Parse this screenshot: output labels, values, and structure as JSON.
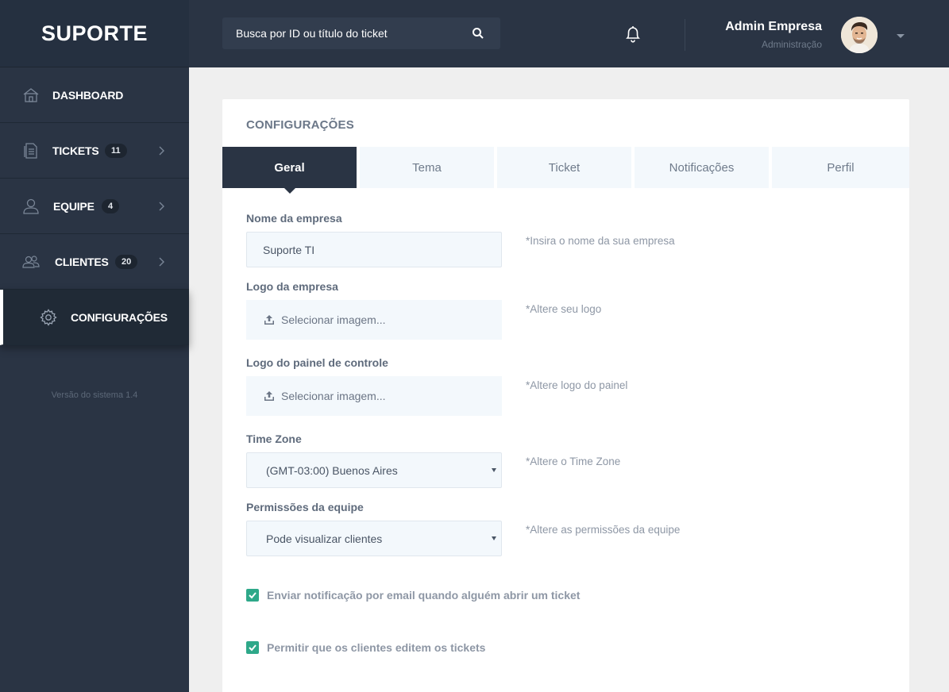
{
  "brand": "SUPORTE",
  "search": {
    "placeholder": "Busca por ID ou título do ticket"
  },
  "user": {
    "name": "Admin Empresa",
    "role": "Administração"
  },
  "sidebar": {
    "items": [
      {
        "label": "DASHBOARD",
        "icon": "home-icon"
      },
      {
        "label": "TICKETS",
        "badge": "11",
        "icon": "document-icon"
      },
      {
        "label": "EQUIPE",
        "badge": "4",
        "icon": "user-icon"
      },
      {
        "label": "CLIENTES",
        "badge": "20",
        "icon": "users-icon"
      },
      {
        "label": "CONFIGURAÇÕES",
        "icon": "gear-icon",
        "active": true
      }
    ],
    "version": "Versão do sistema 1.4"
  },
  "page": {
    "title": "CONFIGURAÇÕES",
    "tabs": [
      "Geral",
      "Tema",
      "Ticket",
      "Notificações",
      "Perfil"
    ],
    "active_tab": "Geral"
  },
  "form": {
    "company_name": {
      "label": "Nome da empresa",
      "value": "Suporte TI",
      "hint": "*Insira o nome da sua empresa"
    },
    "company_logo": {
      "label": "Logo da empresa",
      "button": "Selecionar imagem...",
      "hint": "*Altere seu logo"
    },
    "panel_logo": {
      "label": "Logo do painel de controle",
      "button": "Selecionar imagem...",
      "hint": "*Altere logo do painel"
    },
    "timezone": {
      "label": "Time Zone",
      "value": "(GMT-03:00) Buenos Aires",
      "hint": "*Altere o Time Zone"
    },
    "permissions": {
      "label": "Permissões da equipe",
      "value": "Pode visualizar clientes",
      "hint": "*Altere as permissões da equipe"
    },
    "checkboxes": [
      {
        "label": "Enviar notificação por email quando alguém abrir um ticket",
        "checked": true
      },
      {
        "label": "Permitir que os clientes editem os tickets",
        "checked": true
      }
    ]
  },
  "colors": {
    "sidebar": "#2a3444",
    "accent_check": "#2ea889",
    "tab_bg": "#f3f8fc"
  }
}
